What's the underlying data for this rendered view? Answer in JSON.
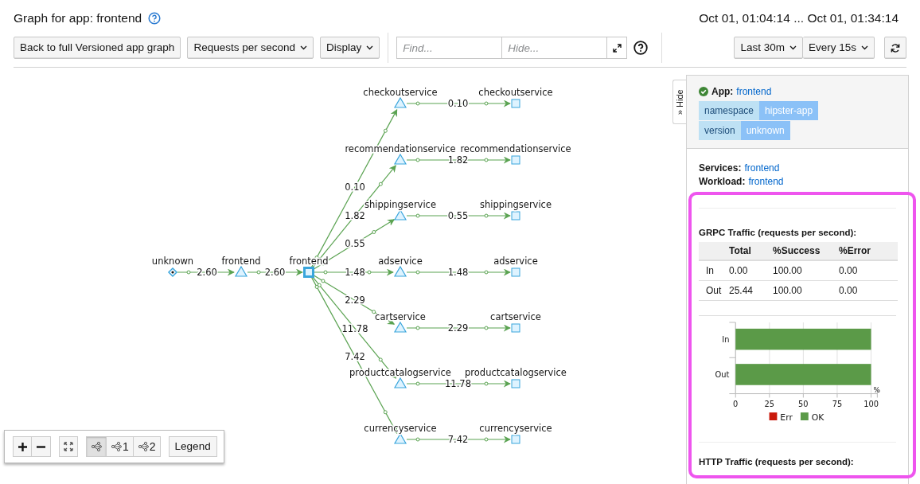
{
  "header": {
    "title": "Graph for app: frontend",
    "time_range": "Oct 01, 01:04:14 ... Oct 01, 01:34:14"
  },
  "toolbar": {
    "back_button": "Back to full Versioned app graph",
    "edge_label_dropdown": "Requests per second",
    "display_dropdown": "Display",
    "find": {
      "placeholder": "Find..."
    },
    "hide": {
      "placeholder": "Hide..."
    },
    "duration_dropdown": "Last 30m",
    "refresh_dropdown": "Every 15s"
  },
  "graph": {
    "nodes": [
      {
        "label": "unknown",
        "kind": "unknown"
      },
      {
        "label": "frontend",
        "kind": "service"
      },
      {
        "label": "frontend",
        "kind": "app"
      },
      {
        "label": "checkoutservice",
        "kind": "service"
      },
      {
        "label": "recommendationservice",
        "kind": "service"
      },
      {
        "label": "shippingservice",
        "kind": "service"
      },
      {
        "label": "adservice",
        "kind": "service"
      },
      {
        "label": "cartservice",
        "kind": "service"
      },
      {
        "label": "productcatalogservice",
        "kind": "service"
      },
      {
        "label": "currencyservice",
        "kind": "service"
      },
      {
        "label": "checkoutservice",
        "kind": "workload"
      },
      {
        "label": "recommendationservice",
        "kind": "workload"
      },
      {
        "label": "shippingservice",
        "kind": "workload"
      },
      {
        "label": "adservice",
        "kind": "workload"
      },
      {
        "label": "cartservice",
        "kind": "workload"
      },
      {
        "label": "productcatalogservice",
        "kind": "workload"
      },
      {
        "label": "currencyservice",
        "kind": "workload"
      }
    ],
    "edges": [
      {
        "label": "2.60"
      },
      {
        "label": "2.60"
      },
      {
        "label": "0.10"
      },
      {
        "label": "1.82"
      },
      {
        "label": "0.55"
      },
      {
        "label": "1.48"
      },
      {
        "label": "2.29"
      },
      {
        "label": "11.78"
      },
      {
        "label": "7.42"
      },
      {
        "label": "0.10"
      },
      {
        "label": "1.82"
      },
      {
        "label": "0.55"
      },
      {
        "label": "1.48"
      },
      {
        "label": "2.29"
      },
      {
        "label": "11.78"
      },
      {
        "label": "7.42"
      }
    ]
  },
  "zoom_toolbar": {
    "layouts": [
      {
        "selected": true
      },
      {
        "label": "1",
        "selected": false
      },
      {
        "label": "2",
        "selected": false
      }
    ],
    "legend_button": "Legend"
  },
  "side_panel": {
    "hide_tab": "» Hide",
    "app_label": "App:",
    "app_name": "frontend",
    "labels": [
      {
        "key": "namespace",
        "value": "hipster-app"
      },
      {
        "key": "version",
        "value": "unknown"
      }
    ],
    "services": {
      "label": "Services:",
      "value": "frontend"
    },
    "workload": {
      "label": "Workload:",
      "value": "frontend"
    },
    "grpc": {
      "title": "GRPC Traffic (requests per second):",
      "columns": [
        "Total",
        "%Success",
        "%Error"
      ],
      "rows": [
        {
          "label": "In",
          "cells": [
            "0.00",
            "100.00",
            "0.00"
          ]
        },
        {
          "label": "Out",
          "cells": [
            "25.44",
            "100.00",
            "0.00"
          ]
        }
      ],
      "chart_data": {
        "type": "bar",
        "orientation": "horizontal",
        "stacked": true,
        "categories": [
          "In",
          "Out"
        ],
        "series": [
          {
            "name": "Err",
            "color": "#c9190b",
            "values": [
              0,
              0
            ]
          },
          {
            "name": "OK",
            "color": "#5b9a48",
            "values": [
              100,
              100
            ]
          }
        ],
        "grid": true,
        "xlim": [
          0,
          100
        ],
        "xticks": [
          0,
          25,
          50,
          75,
          100
        ],
        "xlabel": "%"
      }
    },
    "http_title": "HTTP Traffic (requests per second):"
  }
}
